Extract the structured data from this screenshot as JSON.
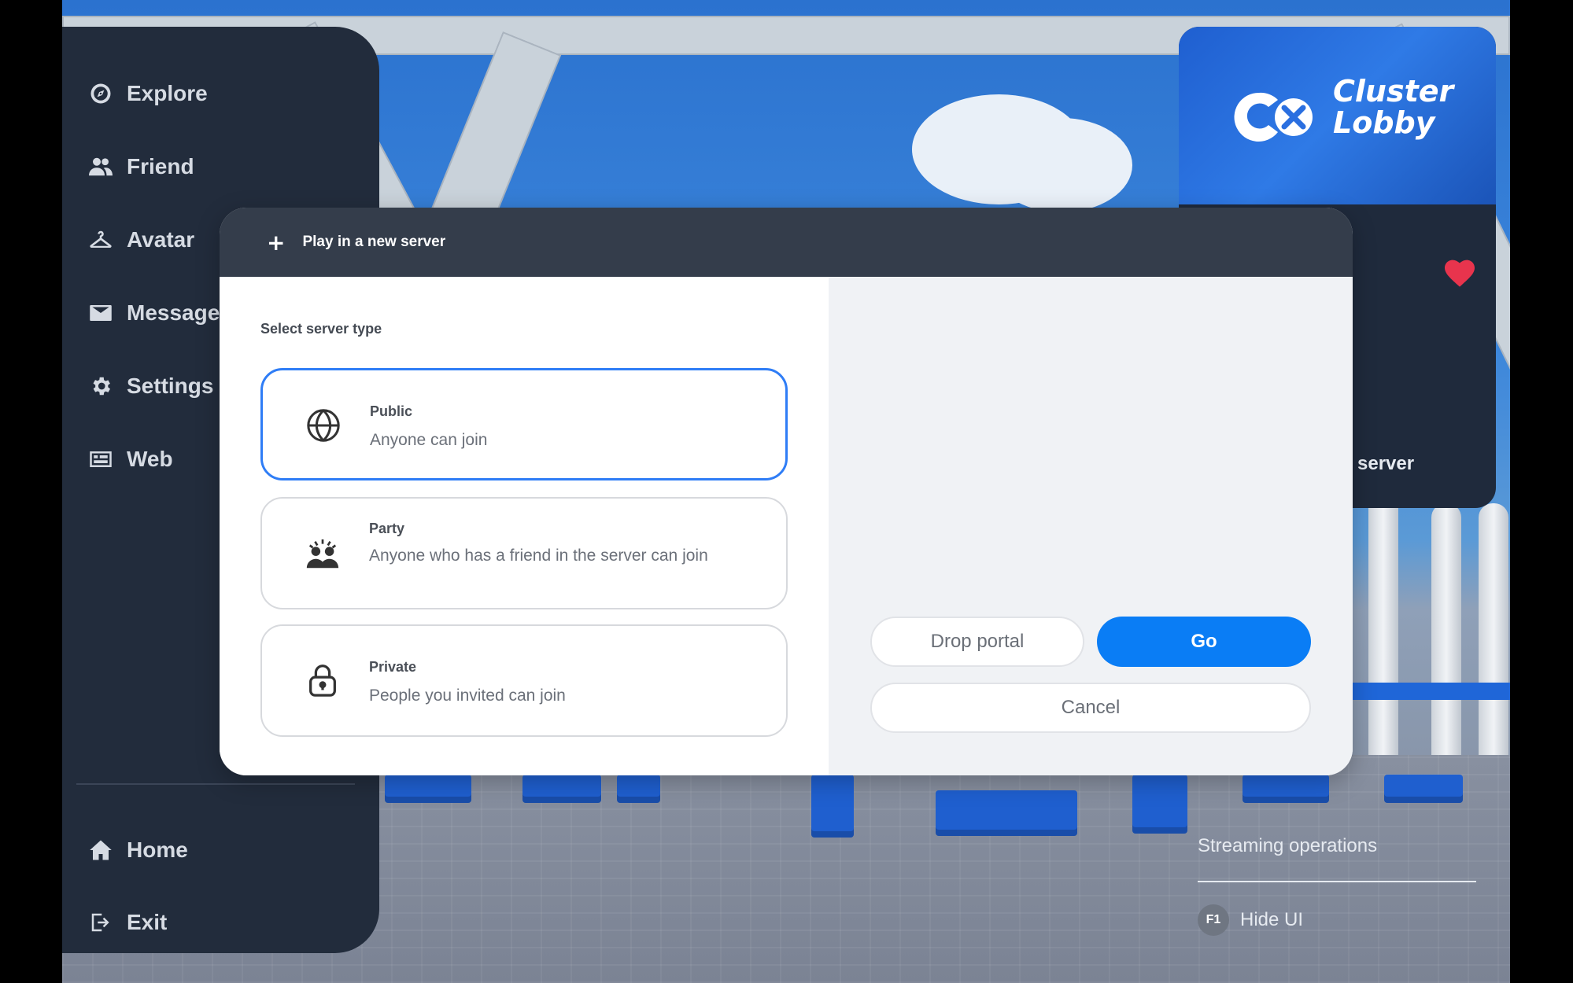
{
  "nav": {
    "items": [
      {
        "label": "Explore",
        "icon": "compass-icon"
      },
      {
        "label": "Friend",
        "icon": "friends-icon"
      },
      {
        "label": "Avatar",
        "icon": "hanger-icon"
      },
      {
        "label": "Message",
        "icon": "mail-icon"
      },
      {
        "label": "Settings",
        "icon": "gear-icon"
      },
      {
        "label": "Web",
        "icon": "web-icon"
      }
    ],
    "bottom": [
      {
        "label": "Home",
        "icon": "home-icon"
      },
      {
        "label": "Exit",
        "icon": "exit-icon"
      }
    ]
  },
  "world_card": {
    "title_line1": "Cluster",
    "title_line2": "Lobby",
    "server_text": "server",
    "favorite": true
  },
  "dialog": {
    "title": "Play in a new server",
    "section_label": "Select server type",
    "options": [
      {
        "title": "Public",
        "description": "Anyone can join",
        "icon": "globe-icon",
        "selected": true
      },
      {
        "title": "Party",
        "description": "Anyone who has a friend in the server can join",
        "icon": "party-icon",
        "selected": false
      },
      {
        "title": "Private",
        "description": "People you invited can join",
        "icon": "lock-icon",
        "selected": false
      }
    ],
    "buttons": {
      "drop_portal": "Drop portal",
      "go": "Go",
      "cancel": "Cancel"
    }
  },
  "status": {
    "streaming": "Streaming operations",
    "hide_ui_key": "F1",
    "hide_ui_label": "Hide UI"
  },
  "colors": {
    "accent": "#0a7df5",
    "selected_border": "#2f7df6",
    "sidebar_bg": "#222c3c",
    "header_bg": "#343d4b",
    "heart": "#e8344d"
  }
}
